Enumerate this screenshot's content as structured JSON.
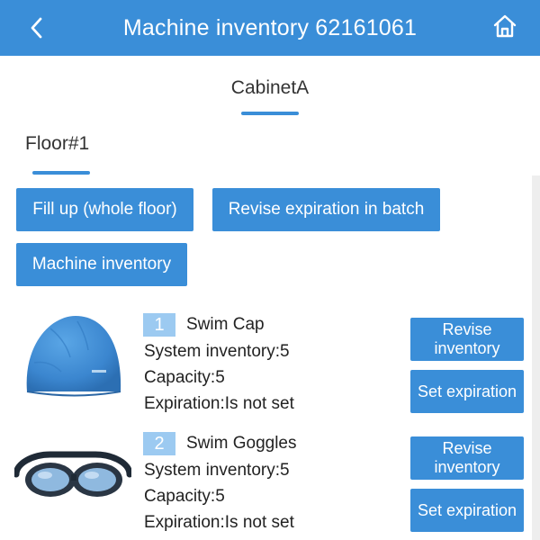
{
  "header": {
    "title": "Machine inventory 62161061",
    "back_icon": "chevron-left-icon",
    "home_icon": "home-icon",
    "background": "#3a8ed8"
  },
  "cabinet_tab": {
    "label": "CabinetA"
  },
  "floor_tab": {
    "label": "Floor#1"
  },
  "actions": {
    "fill_up": "Fill up (whole floor)",
    "revise_batch": "Revise expiration in batch",
    "machine_inventory": "Machine inventory"
  },
  "products": [
    {
      "number": "1",
      "name": "Swim Cap",
      "system_inventory": "System inventory:5",
      "capacity": "Capacity:5",
      "expiration": "Expiration:Is not set",
      "revise_label": "Revise inventory",
      "expire_label": "Set expiration",
      "image": "swim-cap-image"
    },
    {
      "number": "2",
      "name": "Swim Goggles",
      "system_inventory": "System inventory:5",
      "capacity": "Capacity:5",
      "expiration": "Expiration:Is not set",
      "revise_label": "Revise inventory",
      "expire_label": "Set expiration",
      "image": "swim-goggles-image"
    }
  ]
}
